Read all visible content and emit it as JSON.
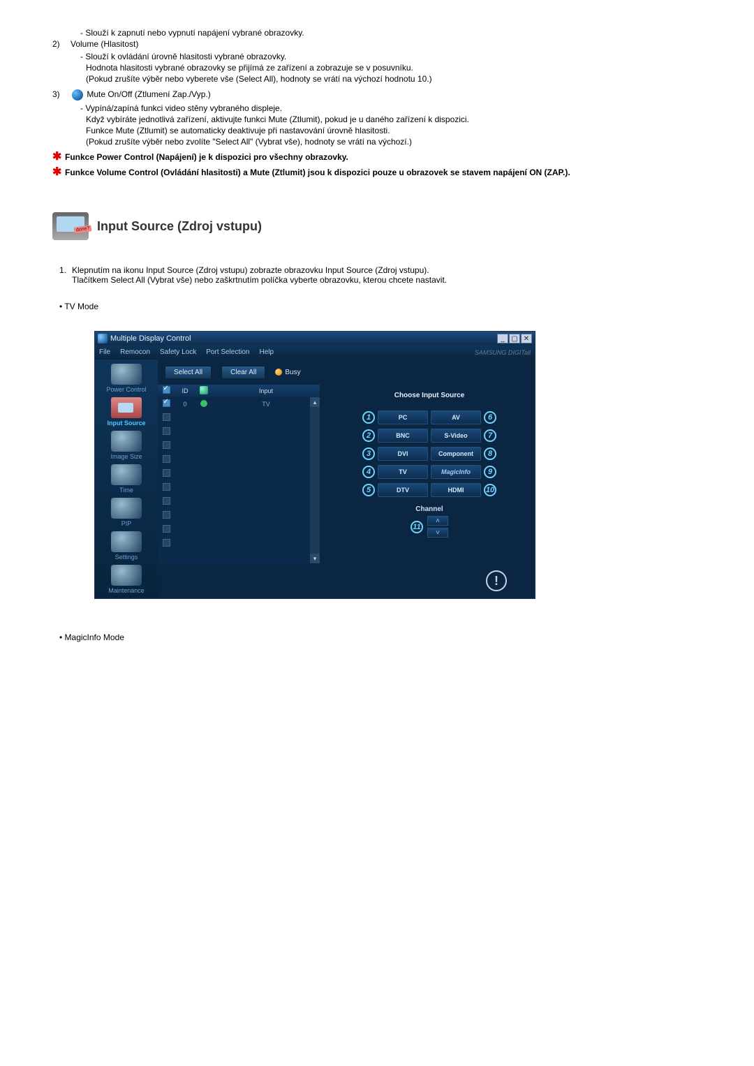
{
  "doc": {
    "line_power_desc": "- Slouží k zapnutí nebo vypnutí napájení vybrané obrazovky.",
    "item2_label": "2)",
    "item2_text": "Volume (Hlasitost)",
    "item2_sub1": "- Slouží k ovládání úrovně hlasitosti vybrané obrazovky.",
    "item2_sub2": "Hodnota hlasitosti vybrané obrazovky se přijímá ze zařízení a zobrazuje se v posuvníku.",
    "item2_sub3": "(Pokud zrušíte výběr nebo vyberete vše (Select All), hodnoty se vrátí na výchozí hodnotu 10.)",
    "item3_label": "3)",
    "item3_text": " Mute On/Off (Ztlumení Zap./Vyp.)",
    "item3_sub1": "- Vypíná/zapíná funkci video stěny vybraného displeje.",
    "item3_sub2": "Když vybíráte jednotlivá zařízení, aktivujte funkci Mute (Ztlumit), pokud je u daného zařízení k dispozici.",
    "item3_sub3": "Funkce Mute (Ztlumit) se automaticky deaktivuje při nastavování úrovně hlasitosti.",
    "item3_sub4": "(Pokud zrušíte výběr nebo zvolíte \"Select All\" (Vybrat vše), hodnoty se vrátí na výchozí.)",
    "star1": "Funkce Power Control (Napájení) je k dispozici pro všechny obrazovky.",
    "star2": "Funkce Volume Control (Ovládání hlasitosti) a Mute (Ztlumit) jsou k dispozici pouze u obrazovek se stavem napájení ON (ZAP.).",
    "section_icon_label": "done?",
    "section_title": "Input Source (Zdroj vstupu)",
    "ol1_num": "1.",
    "ol1_line1": "Klepnutím na ikonu Input Source (Zdroj vstupu) zobrazte obrazovku Input Source (Zdroj vstupu).",
    "ol1_line2": "Tlačítkem Select All (Vybrat vše) nebo zaškrtnutím políčka vyberte obrazovku, kterou chcete nastavit.",
    "bullet_tvmode": "• TV Mode",
    "bullet_magicinfo": "• MagicInfo Mode"
  },
  "app": {
    "title": "Multiple Display Control",
    "menu": {
      "file": "File",
      "remocon": "Remocon",
      "safety": "Safety Lock",
      "port": "Port Selection",
      "help": "Help"
    },
    "brand": "SAMSUNG DIGITall",
    "sidebar": {
      "power": "Power Control",
      "input": "Input Source",
      "image": "Image Size",
      "time": "Time",
      "pip": "PIP",
      "settings": "Settings",
      "maintenance": "Maintenance"
    },
    "toolbar": {
      "select_all": "Select All",
      "clear_all": "Clear All",
      "busy": "Busy"
    },
    "table": {
      "hd_id": "ID",
      "hd_input": "Input",
      "row0": {
        "id": "0",
        "input": "TV"
      }
    },
    "panel": {
      "title": "Choose Input Source",
      "sources": {
        "pc": "PC",
        "av": "AV",
        "bnc": "BNC",
        "svideo": "S-Video",
        "dvi": "DVI",
        "component": "Component",
        "tv": "TV",
        "magic": "MagicInfo",
        "dtv": "DTV",
        "hdmi": "HDMI"
      },
      "badges": {
        "b1": "1",
        "b2": "2",
        "b3": "3",
        "b4": "4",
        "b5": "5",
        "b6": "6",
        "b7": "7",
        "b8": "8",
        "b9": "9",
        "b10": "10",
        "b11": "11"
      },
      "channel": "Channel"
    }
  }
}
